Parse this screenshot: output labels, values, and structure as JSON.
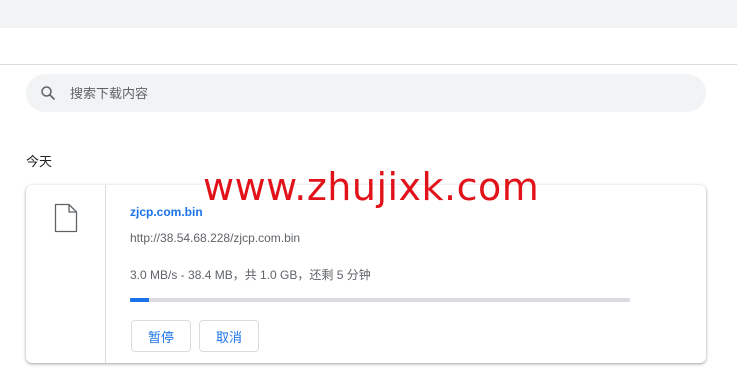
{
  "search": {
    "placeholder": "搜索下载内容",
    "icon": "search-icon"
  },
  "section": {
    "title": "今天"
  },
  "download": {
    "file_name": "zjcp.com.bin",
    "url": "http://38.54.68.228/zjcp.com.bin",
    "status": "3.0 MB/s - 38.4 MB，共 1.0 GB，还剩 5 分钟",
    "progress_fraction": 0.0375,
    "icon": "file-icon",
    "pause_label": "暂停",
    "cancel_label": "取消"
  },
  "watermark": {
    "text": "www.zhujixk.com"
  },
  "colors": {
    "accent": "#1a73e8",
    "watermark": "#e2121a",
    "background_bar": "#f1f3f4"
  }
}
